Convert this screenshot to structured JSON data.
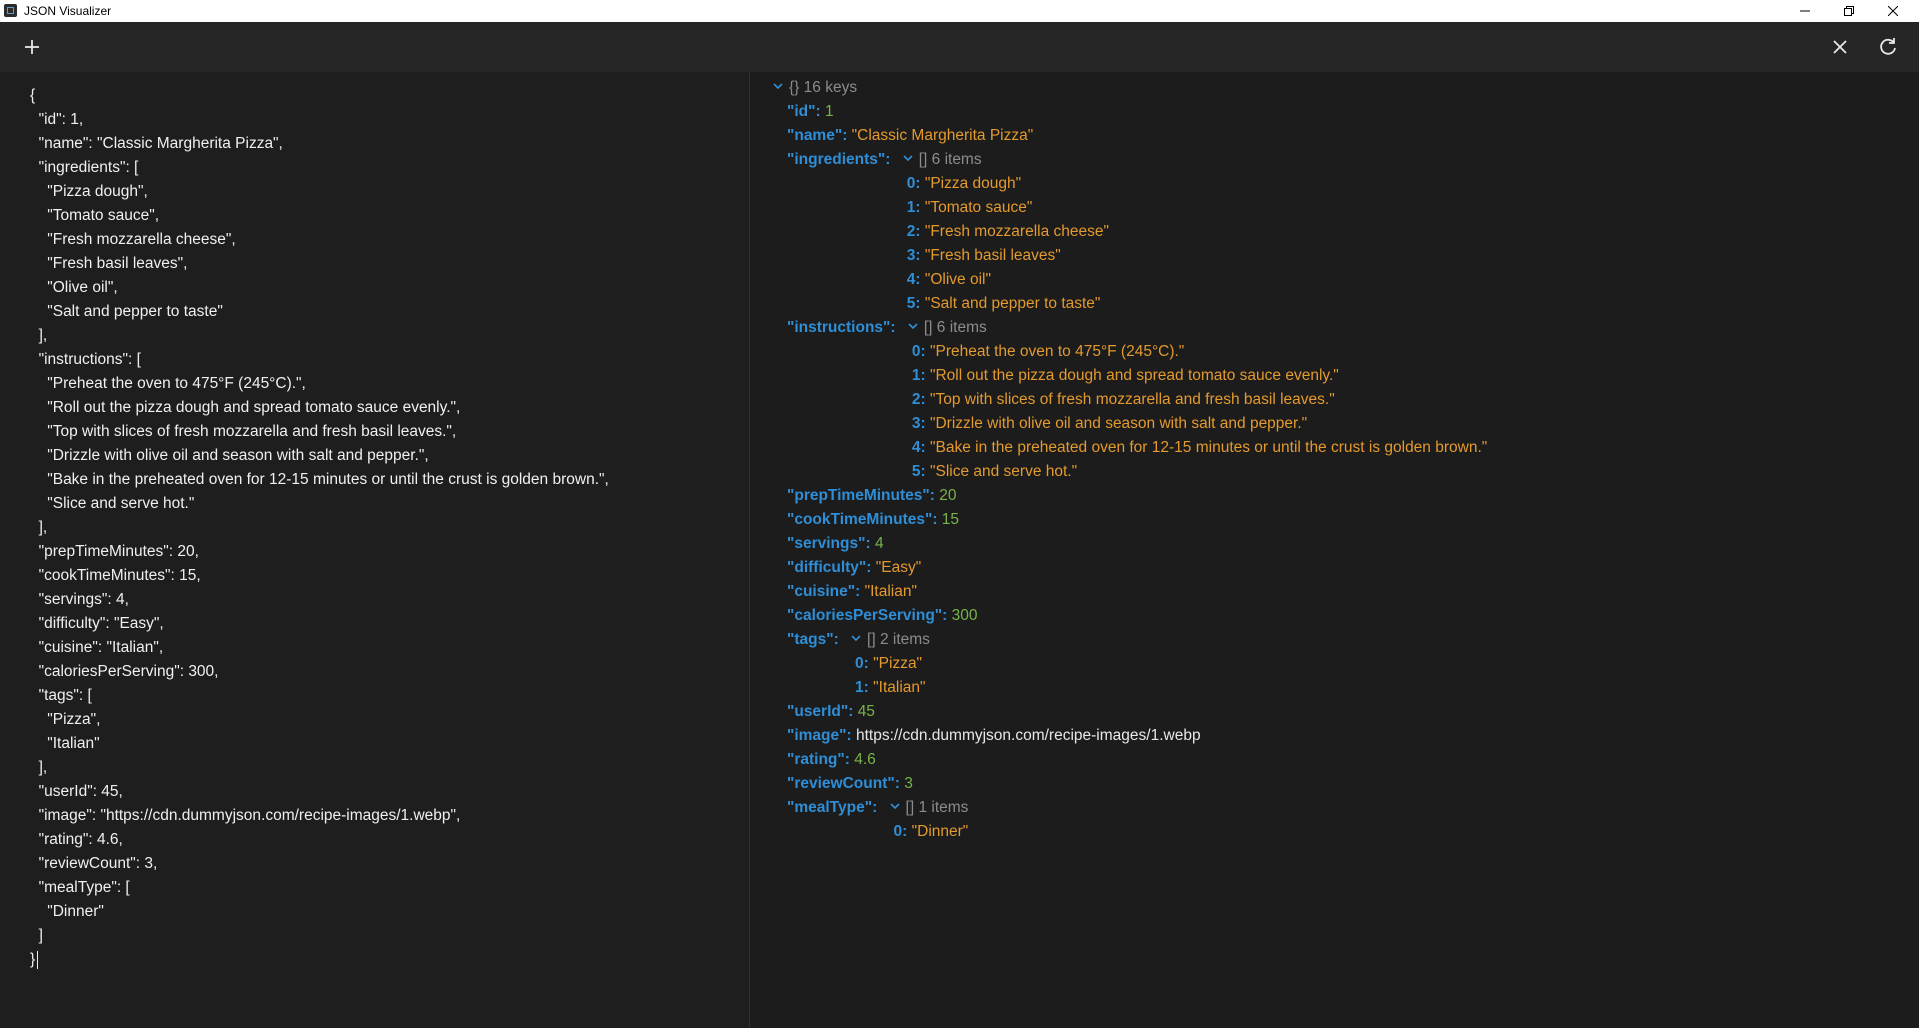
{
  "window": {
    "title": "JSON Visualizer"
  },
  "editor": {
    "lines": [
      "{",
      "  \"id\": 1,",
      "  \"name\": \"Classic Margherita Pizza\",",
      "  \"ingredients\": [",
      "    \"Pizza dough\",",
      "    \"Tomato sauce\",",
      "    \"Fresh mozzarella cheese\",",
      "    \"Fresh basil leaves\",",
      "    \"Olive oil\",",
      "    \"Salt and pepper to taste\"",
      "  ],",
      "  \"instructions\": [",
      "    \"Preheat the oven to 475°F (245°C).\",",
      "    \"Roll out the pizza dough and spread tomato sauce evenly.\",",
      "    \"Top with slices of fresh mozzarella and fresh basil leaves.\",",
      "    \"Drizzle with olive oil and season with salt and pepper.\",",
      "    \"Bake in the preheated oven for 12-15 minutes or until the crust is golden brown.\",",
      "    \"Slice and serve hot.\"",
      "  ],",
      "  \"prepTimeMinutes\": 20,",
      "  \"cookTimeMinutes\": 15,",
      "  \"servings\": 4,",
      "  \"difficulty\": \"Easy\",",
      "  \"cuisine\": \"Italian\",",
      "  \"caloriesPerServing\": 300,",
      "  \"tags\": [",
      "    \"Pizza\",",
      "    \"Italian\"",
      "  ],",
      "  \"userId\": 45,",
      "  \"image\": \"https://cdn.dummyjson.com/recipe-images/1.webp\",",
      "  \"rating\": 4.6,",
      "  \"reviewCount\": 3,",
      "  \"mealType\": [",
      "    \"Dinner\"",
      "  ]",
      "}"
    ]
  },
  "tree": {
    "root_label": "{} 16 keys",
    "rows": [
      {
        "kind": "key",
        "key": "\"id\"",
        "sep": ": ",
        "value": "1",
        "vtype": "num"
      },
      {
        "kind": "key",
        "key": "\"name\"",
        "sep": ": ",
        "value": "\"Classic Margherita Pizza\"",
        "vtype": "str"
      },
      {
        "kind": "array",
        "key": "\"ingredients\"",
        "sep": ": ",
        "meta": "[] 6 items"
      },
      {
        "kind": "item",
        "index": "0:",
        "value": "\"Pizza dough\"",
        "vtype": "str"
      },
      {
        "kind": "item",
        "index": "1:",
        "value": "\"Tomato sauce\"",
        "vtype": "str"
      },
      {
        "kind": "item",
        "index": "2:",
        "value": "\"Fresh mozzarella cheese\"",
        "vtype": "str"
      },
      {
        "kind": "item",
        "index": "3:",
        "value": "\"Fresh basil leaves\"",
        "vtype": "str"
      },
      {
        "kind": "item",
        "index": "4:",
        "value": "\"Olive oil\"",
        "vtype": "str"
      },
      {
        "kind": "item",
        "index": "5:",
        "value": "\"Salt and pepper to taste\"",
        "vtype": "str"
      },
      {
        "kind": "array",
        "key": "\"instructions\"",
        "sep": ": ",
        "meta": "[] 6 items"
      },
      {
        "kind": "item",
        "index": "0:",
        "value": "\"Preheat the oven to 475°F (245°C).\"",
        "vtype": "str"
      },
      {
        "kind": "item",
        "index": "1:",
        "value": "\"Roll out the pizza dough and spread tomato sauce evenly.\"",
        "vtype": "str"
      },
      {
        "kind": "item",
        "index": "2:",
        "value": "\"Top with slices of fresh mozzarella and fresh basil leaves.\"",
        "vtype": "str"
      },
      {
        "kind": "item",
        "index": "3:",
        "value": "\"Drizzle with olive oil and season with salt and pepper.\"",
        "vtype": "str"
      },
      {
        "kind": "item",
        "index": "4:",
        "value": "\"Bake in the preheated oven for 12-15 minutes or until the crust is golden brown.\"",
        "vtype": "str"
      },
      {
        "kind": "item",
        "index": "5:",
        "value": "\"Slice and serve hot.\"",
        "vtype": "str"
      },
      {
        "kind": "key",
        "key": "\"prepTimeMinutes\"",
        "sep": ": ",
        "value": "20",
        "vtype": "num"
      },
      {
        "kind": "key",
        "key": "\"cookTimeMinutes\"",
        "sep": ": ",
        "value": "15",
        "vtype": "num"
      },
      {
        "kind": "key",
        "key": "\"servings\"",
        "sep": ": ",
        "value": "4",
        "vtype": "num"
      },
      {
        "kind": "key",
        "key": "\"difficulty\"",
        "sep": ": ",
        "value": "\"Easy\"",
        "vtype": "str"
      },
      {
        "kind": "key",
        "key": "\"cuisine\"",
        "sep": ": ",
        "value": "\"Italian\"",
        "vtype": "str"
      },
      {
        "kind": "key",
        "key": "\"caloriesPerServing\"",
        "sep": ": ",
        "value": "300",
        "vtype": "num"
      },
      {
        "kind": "array",
        "key": "\"tags\"",
        "sep": ": ",
        "meta": "[] 2 items"
      },
      {
        "kind": "item",
        "index": "0:",
        "value": "\"Pizza\"",
        "vtype": "str"
      },
      {
        "kind": "item",
        "index": "1:",
        "value": "\"Italian\"",
        "vtype": "str"
      },
      {
        "kind": "key",
        "key": "\"userId\"",
        "sep": ": ",
        "value": "45",
        "vtype": "num"
      },
      {
        "kind": "key",
        "key": "\"image\"",
        "sep": ": ",
        "value": "https://cdn.dummyjson.com/recipe-images/1.webp",
        "vtype": "url"
      },
      {
        "kind": "key",
        "key": "\"rating\"",
        "sep": ": ",
        "value": "4.6",
        "vtype": "num"
      },
      {
        "kind": "key",
        "key": "\"reviewCount\"",
        "sep": ": ",
        "value": "3",
        "vtype": "num"
      },
      {
        "kind": "array",
        "key": "\"mealType\"",
        "sep": ": ",
        "meta": "[] 1 items"
      },
      {
        "kind": "item",
        "index": "0:",
        "value": "\"Dinner\"",
        "vtype": "str"
      }
    ]
  },
  "colors": {
    "key": "#2f8ed6",
    "string": "#e39a2f",
    "number": "#79b34a",
    "meta": "#8c8c8c",
    "background": "#1c1c1c"
  },
  "icons": {
    "toolbar_left": "plus-icon",
    "toolbar_right": [
      "close-icon",
      "refresh-icon"
    ],
    "window": [
      "minimize-icon",
      "restore-icon",
      "close-icon"
    ]
  }
}
